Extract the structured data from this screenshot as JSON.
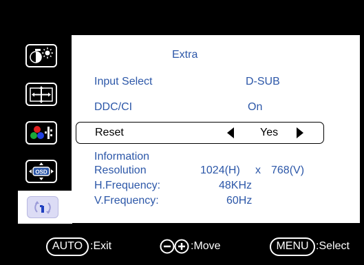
{
  "menu": {
    "title": "Extra",
    "items": [
      {
        "label": "Input Select",
        "value": "D-SUB"
      },
      {
        "label": "DDC/CI",
        "value": "On"
      },
      {
        "label": "Reset",
        "value": "Yes"
      }
    ],
    "information": {
      "heading": "Information",
      "resolution_label": "Resolution",
      "resolution_h": "1024(H)",
      "resolution_x": "x",
      "resolution_v": "768(V)",
      "hfreq_label": "H.Frequency:",
      "hfreq_value": "48KHz",
      "vfreq_label": "V.Frequency:",
      "vfreq_value": "60Hz"
    }
  },
  "sidebar": {
    "icons": [
      "brightness-contrast-icon",
      "position-icon",
      "color-icon",
      "osd-settings-icon",
      "extra-icon"
    ],
    "osd_badge": "OSD",
    "selected_index": 4
  },
  "footer": {
    "auto_key": "AUTO",
    "auto_action": ":Exit",
    "move_action": ":Move",
    "menu_key": "MENU",
    "menu_action": ":Select"
  },
  "colors": {
    "text_accent": "#2c57a8",
    "background": "#000000",
    "panel": "#ffffff"
  }
}
